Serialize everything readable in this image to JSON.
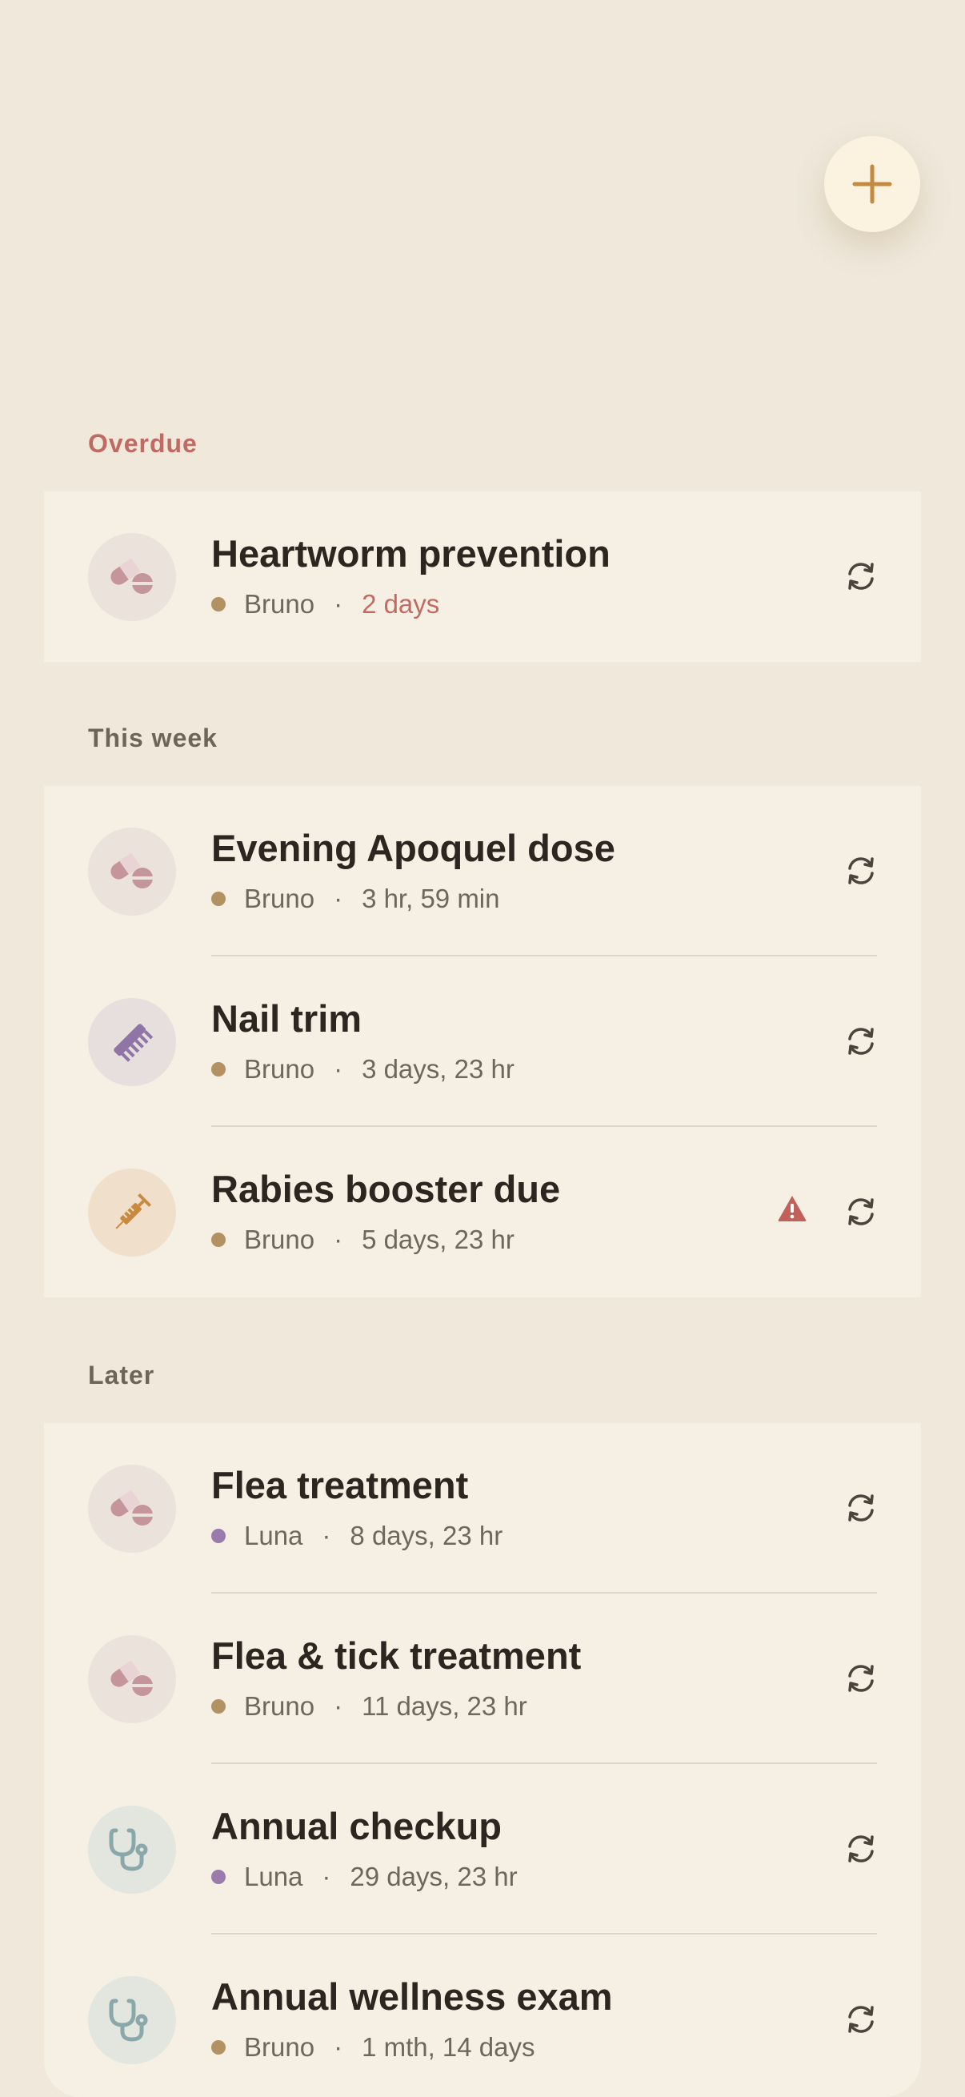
{
  "add_button": {
    "icon": "plus-icon",
    "color": "#c48a3f"
  },
  "sections": [
    {
      "title": "Overdue",
      "title_color": "#c06a63",
      "items": [
        {
          "icon": "pills-icon",
          "title": "Heartworm prevention",
          "pet": "Bruno",
          "pet_color": "#b29163",
          "due": "2 days",
          "due_color": "#c56a63",
          "warning": false
        }
      ]
    },
    {
      "title": "This week",
      "title_color": "#6e6558",
      "items": [
        {
          "icon": "pills-icon",
          "title": "Evening Apoquel dose",
          "pet": "Bruno",
          "pet_color": "#b29163",
          "due": "3 hr, 59 min",
          "due_color": "#6f675c",
          "warning": false
        },
        {
          "icon": "comb-icon",
          "title": "Nail trim",
          "pet": "Bruno",
          "pet_color": "#b29163",
          "due": "3 days, 23 hr",
          "due_color": "#6f675c",
          "warning": false
        },
        {
          "icon": "syringe-icon",
          "title": "Rabies booster due",
          "pet": "Bruno",
          "pet_color": "#b29163",
          "due": "5 days, 23 hr",
          "due_color": "#6f675c",
          "warning": true
        }
      ]
    },
    {
      "title": "Later",
      "title_color": "#6e6558",
      "items": [
        {
          "icon": "pills-icon",
          "title": "Flea treatment",
          "pet": "Luna",
          "pet_color": "#9a7bab",
          "due": "8 days, 23 hr",
          "due_color": "#6f675c",
          "warning": false
        },
        {
          "icon": "pills-icon",
          "title": "Flea & tick treatment",
          "pet": "Bruno",
          "pet_color": "#b29163",
          "due": "11 days, 23 hr",
          "due_color": "#6f675c",
          "warning": false
        },
        {
          "icon": "stethoscope-icon",
          "title": "Annual checkup",
          "pet": "Luna",
          "pet_color": "#9a7bab",
          "due": "29 days, 23 hr",
          "due_color": "#6f675c",
          "warning": false
        },
        {
          "icon": "stethoscope-icon",
          "title": "Annual wellness exam",
          "pet": "Bruno",
          "pet_color": "#b29163",
          "due": "1 mth, 14 days",
          "due_color": "#6f675c",
          "warning": false
        }
      ]
    }
  ]
}
